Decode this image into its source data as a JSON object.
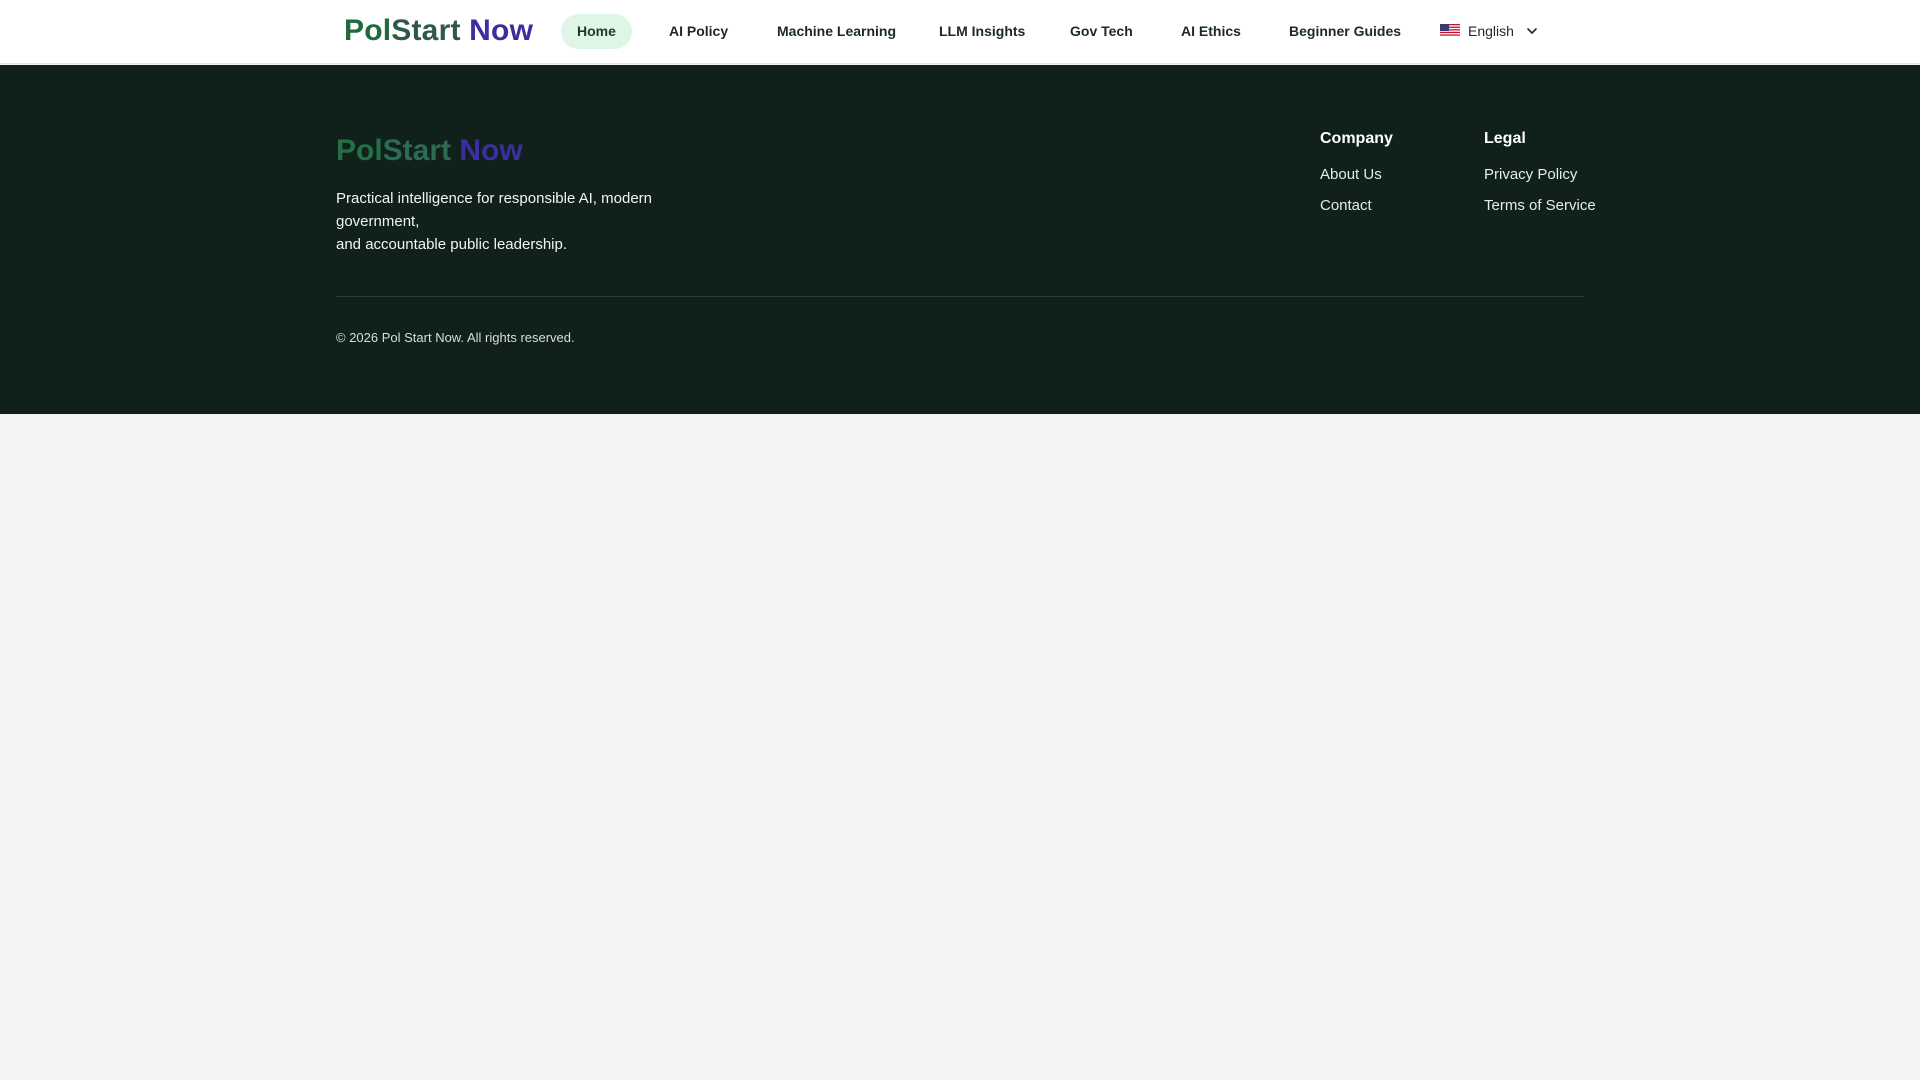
{
  "brand": {
    "logo_part_a": "Pol",
    "logo_part_b": "Start",
    "logo_part_c": " Now",
    "colors": {
      "dark_green": "#1f6a3e",
      "mid_green": "#2d5a45",
      "purple": "#3b2fa0",
      "footer_bg": "#10211b",
      "active_nav_bg": "#dff5e6"
    }
  },
  "nav": {
    "items": [
      {
        "label": "Home",
        "active": true
      },
      {
        "label": "AI Policy",
        "active": false
      },
      {
        "label": "Machine Learning",
        "active": false
      },
      {
        "label": "LLM Insights",
        "active": false
      },
      {
        "label": "Gov Tech",
        "active": false
      },
      {
        "label": "AI Ethics",
        "active": false
      },
      {
        "label": "Beginner Guides",
        "active": false
      }
    ],
    "language": {
      "flag_icon": "us-flag-icon",
      "label": "English",
      "chevron_icon": "chevron-down-icon"
    }
  },
  "footer": {
    "tagline_line1": "Practical intelligence for responsible AI, modern government,",
    "tagline_line2": "and accountable public leadership.",
    "company": {
      "title": "Company",
      "links": [
        "About Us",
        "Contact"
      ]
    },
    "legal": {
      "title": "Legal",
      "links": [
        "Privacy Policy",
        "Terms of Service"
      ]
    },
    "copyright": "© 2026 Pol Start Now. All rights reserved."
  }
}
